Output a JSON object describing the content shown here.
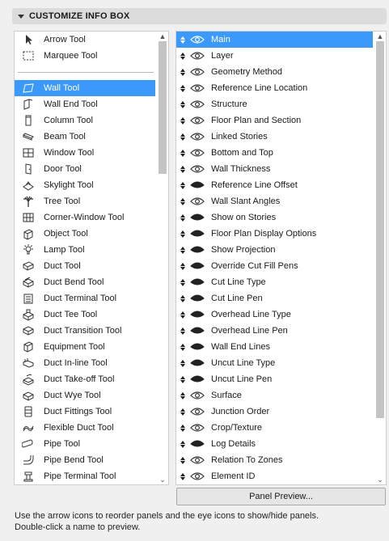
{
  "section_title": "CUSTOMIZE INFO BOX",
  "tools": [
    {
      "label": "Arrow Tool",
      "icon": "arrow"
    },
    {
      "label": "Marquee Tool",
      "icon": "marquee"
    },
    {
      "label": "Wall Tool",
      "icon": "wall",
      "selected": true
    },
    {
      "label": "Wall End Tool",
      "icon": "wall-end"
    },
    {
      "label": "Column Tool",
      "icon": "column"
    },
    {
      "label": "Beam Tool",
      "icon": "beam"
    },
    {
      "label": "Window Tool",
      "icon": "window"
    },
    {
      "label": "Door Tool",
      "icon": "door"
    },
    {
      "label": "Skylight Tool",
      "icon": "skylight"
    },
    {
      "label": "Tree Tool",
      "icon": "tree"
    },
    {
      "label": "Corner-Window Tool",
      "icon": "corner-window"
    },
    {
      "label": "Object Tool",
      "icon": "object"
    },
    {
      "label": "Lamp Tool",
      "icon": "lamp"
    },
    {
      "label": "Duct Tool",
      "icon": "duct"
    },
    {
      "label": "Duct Bend Tool",
      "icon": "duct-bend"
    },
    {
      "label": "Duct Terminal Tool",
      "icon": "duct-terminal"
    },
    {
      "label": "Duct Tee Tool",
      "icon": "duct-tee"
    },
    {
      "label": "Duct Transition Tool",
      "icon": "duct-transition"
    },
    {
      "label": "Equipment Tool",
      "icon": "equipment"
    },
    {
      "label": "Duct In-line Tool",
      "icon": "duct-inline"
    },
    {
      "label": "Duct Take-off Tool",
      "icon": "duct-takeoff"
    },
    {
      "label": "Duct Wye Tool",
      "icon": "duct-wye"
    },
    {
      "label": "Duct Fittings Tool",
      "icon": "duct-fittings"
    },
    {
      "label": "Flexible Duct Tool",
      "icon": "flexible-duct"
    },
    {
      "label": "Pipe Tool",
      "icon": "pipe"
    },
    {
      "label": "Pipe Bend Tool",
      "icon": "pipe-bend"
    },
    {
      "label": "Pipe Terminal Tool",
      "icon": "pipe-terminal"
    }
  ],
  "panels": [
    {
      "label": "Main",
      "visible": true,
      "selected": true
    },
    {
      "label": "Layer",
      "visible": true
    },
    {
      "label": "Geometry Method",
      "visible": true
    },
    {
      "label": "Reference Line Location",
      "visible": true
    },
    {
      "label": "Structure",
      "visible": true
    },
    {
      "label": "Floor Plan and Section",
      "visible": true
    },
    {
      "label": "Linked Stories",
      "visible": true
    },
    {
      "label": "Bottom and Top",
      "visible": true
    },
    {
      "label": "Wall Thickness",
      "visible": true
    },
    {
      "label": "Reference Line Offset",
      "visible": false
    },
    {
      "label": "Wall Slant Angles",
      "visible": true
    },
    {
      "label": "Show on Stories",
      "visible": false
    },
    {
      "label": "Floor Plan Display Options",
      "visible": false
    },
    {
      "label": "Show Projection",
      "visible": false
    },
    {
      "label": "Override Cut Fill Pens",
      "visible": false
    },
    {
      "label": "Cut Line Type",
      "visible": false
    },
    {
      "label": "Cut Line Pen",
      "visible": false
    },
    {
      "label": "Overhead Line Type",
      "visible": false
    },
    {
      "label": "Overhead Line Pen",
      "visible": false
    },
    {
      "label": "Wall End Lines",
      "visible": false
    },
    {
      "label": "Uncut Line Type",
      "visible": false
    },
    {
      "label": "Uncut Line Pen",
      "visible": false
    },
    {
      "label": "Surface",
      "visible": true
    },
    {
      "label": "Junction Order",
      "visible": true
    },
    {
      "label": "Crop/Texture",
      "visible": true
    },
    {
      "label": "Log Details",
      "visible": false
    },
    {
      "label": "Relation To Zones",
      "visible": true
    },
    {
      "label": "Element ID",
      "visible": true
    }
  ],
  "preview_button": "Panel Preview...",
  "help_lines": [
    "Use the arrow icons to reorder panels and the eye icons to show/hide panels.",
    "Double-click a name to preview."
  ],
  "colors": {
    "selection": "#3b99fc"
  }
}
